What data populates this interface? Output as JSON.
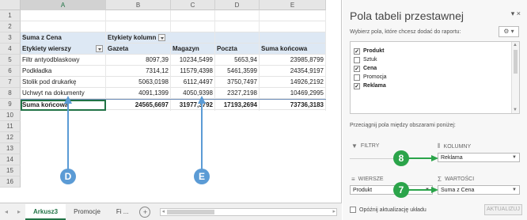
{
  "columns": [
    "A",
    "B",
    "C",
    "D",
    "E"
  ],
  "row_numbers": [
    "1",
    "2",
    "3",
    "4",
    "5",
    "6",
    "7",
    "8",
    "9",
    "10",
    "11",
    "12",
    "13",
    "14",
    "15",
    "16"
  ],
  "pivot": {
    "corner_label": "Suma z Cena",
    "col_labels_header": "Etykiety kolumn",
    "row_labels_header": "Etykiety wierszy",
    "col_headers": [
      "Gazeta",
      "Magazyn",
      "Poczta",
      "Suma końcowa"
    ],
    "rows": [
      {
        "label": "Filtr antyodblaskowy",
        "values": [
          "8097,39",
          "10234,5499",
          "5653,94",
          "23985,8799"
        ]
      },
      {
        "label": "Podkładka",
        "values": [
          "7314,12",
          "11579,4398",
          "5461,3599",
          "24354,9197"
        ]
      },
      {
        "label": "Stolik pod drukarkę",
        "values": [
          "5063,0198",
          "6112,4497",
          "3750,7497",
          "14926,2192"
        ]
      },
      {
        "label": "Uchwyt na dokumenty",
        "values": [
          "4091,1399",
          "4050,9398",
          "2327,2198",
          "10469,2995"
        ]
      }
    ],
    "total_row": {
      "label": "Suma końcowa",
      "values": [
        "24565,6697",
        "31977,3792",
        "17193,2694",
        "73736,3183"
      ]
    }
  },
  "tabs": {
    "nav_prev": "◂",
    "nav_next": "▸",
    "items": [
      "Arkusz3",
      "Promocje",
      "Fi ..."
    ],
    "active_index": 0,
    "add": "+"
  },
  "callouts": {
    "d": "D",
    "e": "E",
    "eight": "8",
    "seven": "7"
  },
  "pane": {
    "title": "Pola tabeli przestawnej",
    "controls": "▾ ×",
    "subtitle": "Wybierz pola, które chcesz dodać do raportu:",
    "gear": "⚙ ▾",
    "fields": [
      {
        "label": "Produkt",
        "checked": true
      },
      {
        "label": "Sztuk",
        "checked": false
      },
      {
        "label": "Cena",
        "checked": true
      },
      {
        "label": "Promocja",
        "checked": false
      },
      {
        "label": "Reklama",
        "checked": true
      }
    ],
    "drag_hint": "Przeciągnij pola między obszarami poniżej:",
    "areas": {
      "filters": "FILTRY",
      "columns": "KOLUMNY",
      "rows": "WIERSZE",
      "values": "WARTOŚCI"
    },
    "chips": {
      "columns": "Reklama",
      "rows": "Produkt",
      "values": "Suma z Cena"
    },
    "defer": "Opóźnij aktualizację układu",
    "update": "AKTUALIZUJ"
  },
  "colors": {
    "accent_green": "#217346",
    "callout_blue": "#5b9bd5",
    "callout_green": "#2ba44a",
    "header_blue": "#dde8f4"
  }
}
